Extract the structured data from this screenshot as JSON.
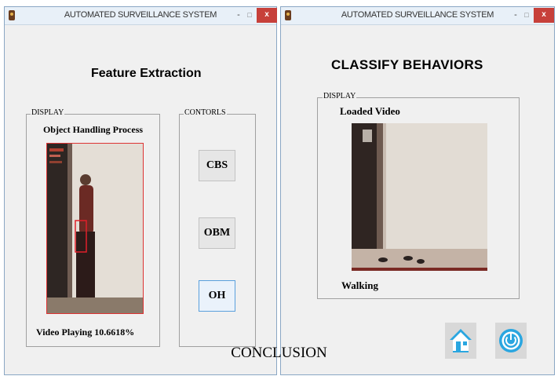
{
  "window_left": {
    "title": "AUTOMATED SURVEILLANCE SYSTEM",
    "minimize_glyph": "-",
    "maximize_glyph": "□",
    "close_glyph": "x",
    "heading": "Feature Extraction",
    "display_label": "DISPLAY",
    "display_title": "Object Handling Process",
    "status": "Video Playing 10.6618%",
    "controls_label": "CONTORLS",
    "buttons": [
      "CBS",
      "OBM",
      "OH"
    ]
  },
  "window_right": {
    "title": "AUTOMATED SURVEILLANCE SYSTEM",
    "minimize_glyph": "-",
    "maximize_glyph": "□",
    "close_glyph": "x",
    "heading": "CLASSIFY BEHAVIORS",
    "display_label": "DISPLAY",
    "display_title": "Loaded Video",
    "result": "Walking",
    "icons": [
      "home-icon",
      "power-icon"
    ]
  },
  "caption": "CONCLUSION",
  "colors": {
    "window_bg": "#f0f0f0",
    "titlebar": "#e8f0f8",
    "close_button": "#c7403a",
    "detection_box": "#e0202a",
    "icon_accent": "#2aa6e0"
  }
}
